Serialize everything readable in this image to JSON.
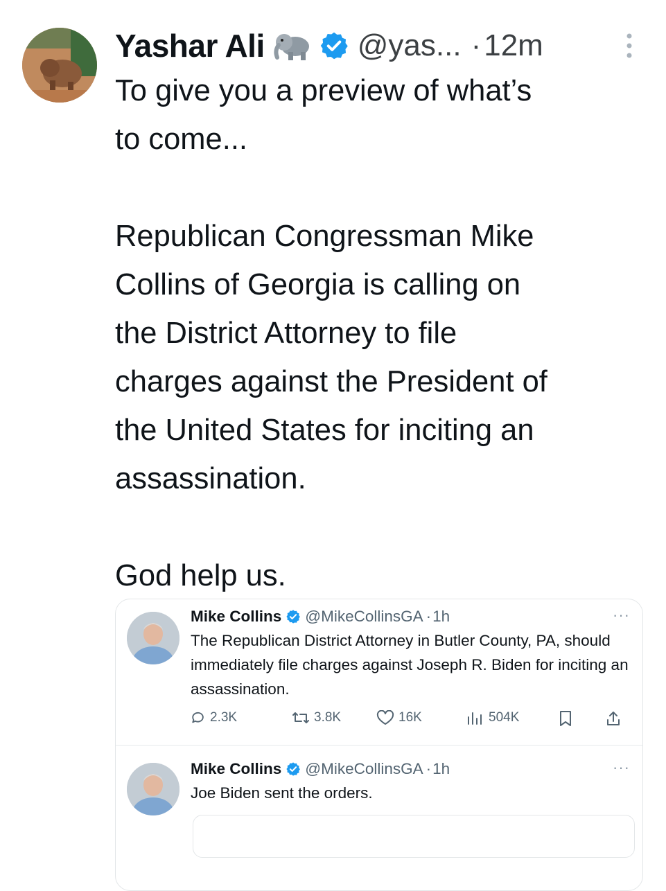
{
  "tweet": {
    "author_name": "Yashar Ali",
    "author_emoji": "elephant-emoji",
    "verified": "verified-badge",
    "handle": "@yas...",
    "separator": "·",
    "time": "12m",
    "text": "To give you a preview of what’s\nto come...\n\nRepublican Congressman Mike\nCollins of Georgia is calling on\nthe District Attorney to file\ncharges against the President of\nthe United States for inciting an\nassassination.\n\nGod help us.",
    "more_icon": "more-vertical-icon"
  },
  "quoted": {
    "posts": [
      {
        "author_name": "Mike Collins",
        "handle": "@MikeCollinsGA",
        "separator": "·",
        "time": "1h",
        "more": "···",
        "text": "The Republican District Attorney in Butler County, PA, should immediately file charges against Joseph R. Biden for inciting an assassination.",
        "actions": {
          "replies": "2.3K",
          "reposts": "3.8K",
          "likes": "16K",
          "views": "504K"
        }
      },
      {
        "author_name": "Mike Collins",
        "handle": "@MikeCollinsGA",
        "separator": "·",
        "time": "1h",
        "more": "···",
        "text": "Joe Biden sent the orders."
      }
    ]
  },
  "colors": {
    "text": "#0f1419",
    "secondary": "#536471",
    "verified": "#1d9bf0",
    "border": "#e3e6e8"
  }
}
